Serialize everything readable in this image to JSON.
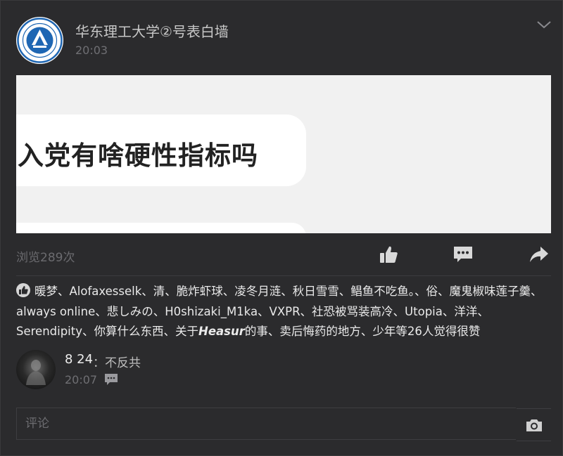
{
  "post": {
    "author": "华东理工大学②号表白墙",
    "time": "20:03",
    "image_text": "入党有啥硬性指标吗",
    "views": "浏览289次"
  },
  "likes": {
    "names_part1": "暖梦、Alofaxesselk、清、脆炸虾球、凌冬月涟、秋日雪雪、鲳鱼不吃鱼。、俗、魔鬼椒味莲子羹、always online、悲しみの、H0shizaki_M1ka、VXPR、社恐被骂装高冷、Utopia、洋洋、Serendipity、你算什么东西、关于",
    "names_emph": "Heasur",
    "names_part2": "的事、卖后悔药的地方、少年等26人觉得很赞"
  },
  "comment": {
    "author": "8 24",
    "text": "：不反共",
    "time": "20:07"
  },
  "comment_input": {
    "placeholder": "评论"
  },
  "icons": {
    "like": "thumbs-up-icon",
    "comment": "comment-bubble-icon",
    "share": "share-arrow-icon",
    "camera": "camera-icon",
    "collapse": "chevron-down-icon"
  },
  "colors": {
    "background": "#2b2b2d",
    "icon": "#d9d9d9",
    "muted_text": "#6f6f73"
  }
}
